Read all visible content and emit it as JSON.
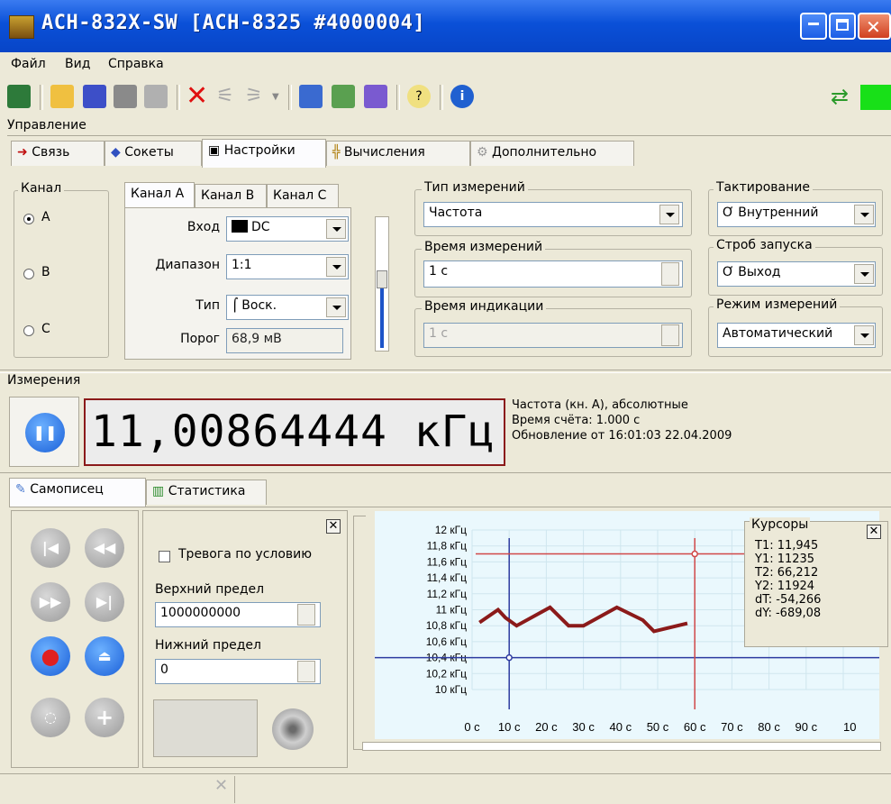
{
  "window": {
    "title": "АСН-832X-SW [АСН-8325 #4000004]"
  },
  "menu": {
    "file": "Файл",
    "view": "Вид",
    "help": "Справка"
  },
  "control": {
    "section_label": "Управление",
    "tabs": [
      "Связь",
      "Сокеты",
      "Настройки",
      "Вычисления",
      "Дополнительно"
    ],
    "channel_group": "Канал",
    "channel_options": [
      "A",
      "B",
      "C"
    ],
    "channel_tabs": [
      "Канал A",
      "Канал B",
      "Канал C"
    ],
    "input_label": "Вход",
    "input_value": "DC",
    "range_label": "Диапазон",
    "range_value": "1:1",
    "type_label": "Тип",
    "type_value": "Воск.",
    "threshold_label": "Порог",
    "threshold_value": "68,9 мВ",
    "meas_type_group": "Тип измерений",
    "meas_type_value": "Частота",
    "meas_time_group": "Время измерений",
    "meas_time_value": "1 с",
    "display_time_group": "Время индикации",
    "display_time_value": "1 с",
    "clock_group": "Тактирование",
    "clock_value": "Внутренний",
    "strobe_group": "Строб запуска",
    "strobe_value": "Выход",
    "mode_group": "Режим измерений",
    "mode_value": "Автоматический"
  },
  "measurement": {
    "section_label": "Измерения",
    "reading": "11,00864444 кГц",
    "info_1": "Частота (кн. А), абсолютные",
    "info_2": "Время счёта: 1.000 с",
    "info_3": "Обновление от 16:01:03 22.04.2009"
  },
  "recorder": {
    "tabs": [
      "Самописец",
      "Статистика"
    ],
    "alarm_label": "Тревога по условию",
    "upper_label": "Верхний предел",
    "upper_value": "1000000000",
    "lower_label": "Нижний предел",
    "lower_value": "0"
  },
  "cursors": {
    "title": "Курсоры",
    "t1": "T1: 11,945",
    "y1": "Y1: 11235",
    "t2": "T2: 66,212",
    "y2": "Y2: 11924",
    "dt": "dT: -54,266",
    "dy": "dY: -689,08"
  },
  "chart_data": {
    "type": "line",
    "y_unit": "кГц",
    "y_ticks": [
      "12 кГц",
      "11,8 кГц",
      "11,6 кГц",
      "11,4 кГц",
      "11,2 кГц",
      "11 кГц",
      "10,8 кГц",
      "10,6 кГц",
      "10,4 кГц",
      "10,2 кГц",
      "10 кГц"
    ],
    "x_ticks": [
      "0 с",
      "10 с",
      "20 с",
      "30 с",
      "40 с",
      "50 с",
      "60 с",
      "70 с",
      "80 с",
      "90 с",
      "10"
    ],
    "x_values": [
      0,
      10,
      20,
      30,
      40,
      50,
      60,
      70,
      80,
      90
    ],
    "ylim": [
      10,
      12
    ],
    "series": [
      {
        "x": [
          2,
          7,
          9,
          12,
          21,
          26,
          30,
          39,
          46,
          49,
          58
        ],
        "y": [
          10.84,
          11.0,
          10.9,
          10.8,
          11.03,
          10.8,
          10.8,
          11.03,
          10.87,
          10.73,
          10.83
        ]
      }
    ],
    "cursor_x": [
      10,
      60
    ],
    "cursor_y": [
      10.4,
      11.7
    ],
    "colors": {
      "line": "#8b1a1a",
      "cursor_blue": "#2d3ba0",
      "cursor_red": "#d04848",
      "background": "#eaf8fd"
    }
  }
}
